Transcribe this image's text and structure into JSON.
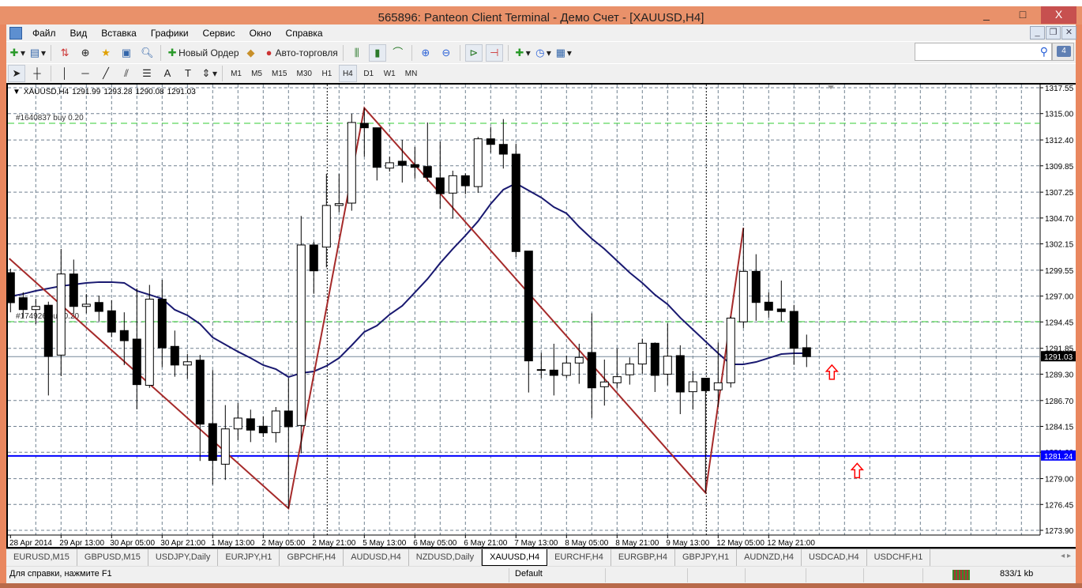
{
  "window": {
    "title": "565896: Panteon Client Terminal - Демо Счет - [XAUUSD,H4]",
    "minimize": "_",
    "maximize": "□",
    "close": "X"
  },
  "menu": [
    "Файл",
    "Вид",
    "Вставка",
    "Графики",
    "Сервис",
    "Окно",
    "Справка"
  ],
  "mdi": {
    "minimize": "_",
    "restore": "❐",
    "close": "✕"
  },
  "toolbar": {
    "new_order": "Новый Ордер",
    "auto_trading": "Авто-торговля",
    "messages_count": "4",
    "search_placeholder": ""
  },
  "timeframes": [
    "M1",
    "M5",
    "M15",
    "M30",
    "H1",
    "H4",
    "D1",
    "W1",
    "MN"
  ],
  "active_timeframe": "H4",
  "chart": {
    "symbol": "XAUUSD,H4",
    "open": "1291.99",
    "high": "1293.28",
    "low": "1290.08",
    "close": "1291.03"
  },
  "chart_data": {
    "type": "candlestick",
    "symbol": "XAUUSD",
    "timeframe": "H4",
    "ylim": [
      1273.9,
      1317.55
    ],
    "price_ticks": [
      "1317.55",
      "1315.00",
      "1312.40",
      "1309.85",
      "1307.25",
      "1304.70",
      "1302.15",
      "1299.55",
      "1297.00",
      "1294.45",
      "1291.85",
      "1289.30",
      "1286.70",
      "1284.15",
      "1281.60",
      "1279.00",
      "1276.45",
      "1273.90"
    ],
    "time_labels": [
      {
        "index": 0,
        "label": "28 Apr 2014"
      },
      {
        "index": 4,
        "label": "29 Apr 13:00"
      },
      {
        "index": 8,
        "label": "30 Apr 05:00"
      },
      {
        "index": 12,
        "label": "30 Apr 21:00"
      },
      {
        "index": 16,
        "label": "1 May 13:00"
      },
      {
        "index": 20,
        "label": "2 May 05:00"
      },
      {
        "index": 24,
        "label": "2 May 21:00"
      },
      {
        "index": 28,
        "label": "5 May 13:00"
      },
      {
        "index": 32,
        "label": "6 May 05:00"
      },
      {
        "index": 36,
        "label": "6 May 21:00"
      },
      {
        "index": 40,
        "label": "7 May 13:00"
      },
      {
        "index": 44,
        "label": "8 May 05:00"
      },
      {
        "index": 48,
        "label": "8 May 21:00"
      },
      {
        "index": 52,
        "label": "9 May 13:00"
      },
      {
        "index": 56,
        "label": "12 May 05:00"
      },
      {
        "index": 60,
        "label": "12 May 21:00"
      }
    ],
    "ohlc": [
      [
        1299.31,
        1299.7,
        1295.4,
        1296.35
      ],
      [
        1296.84,
        1297.37,
        1294.89,
        1295.67
      ],
      [
        1295.67,
        1296.74,
        1294.24,
        1295.98
      ],
      [
        1296.1,
        1296.45,
        1287.2,
        1291.05
      ],
      [
        1291.18,
        1301.65,
        1289.1,
        1299.18
      ],
      [
        1299.18,
        1300.6,
        1295.3,
        1295.98
      ],
      [
        1295.98,
        1297.2,
        1295.3,
        1296.2
      ],
      [
        1296.37,
        1297.05,
        1294.5,
        1295.49
      ],
      [
        1295.55,
        1296.6,
        1292.95,
        1293.45
      ],
      [
        1293.6,
        1295.4,
        1290.2,
        1292.6
      ],
      [
        1292.76,
        1297.75,
        1285.83,
        1288.27
      ],
      [
        1288.2,
        1298.1,
        1287.95,
        1296.7
      ],
      [
        1296.7,
        1298.6,
        1290.0,
        1291.9
      ],
      [
        1292.04,
        1293.6,
        1289.05,
        1290.2
      ],
      [
        1290.2,
        1291.3,
        1288.85,
        1290.52
      ],
      [
        1290.68,
        1291.2,
        1280.74,
        1284.37
      ],
      [
        1284.42,
        1289.7,
        1278.4,
        1280.79
      ],
      [
        1280.42,
        1286.25,
        1278.87,
        1283.9
      ],
      [
        1283.9,
        1286.45,
        1282.8,
        1284.97
      ],
      [
        1284.9,
        1285.8,
        1282.6,
        1283.78
      ],
      [
        1284.17,
        1285.15,
        1283.1,
        1283.51
      ],
      [
        1283.54,
        1286.06,
        1282.56,
        1285.67
      ],
      [
        1285.67,
        1288.92,
        1276.06,
        1284.11
      ],
      [
        1284.24,
        1304.9,
        1281.5,
        1302.04
      ],
      [
        1302.04,
        1302.35,
        1297.23,
        1299.49
      ],
      [
        1301.83,
        1309.05,
        1299.83,
        1305.94
      ],
      [
        1305.94,
        1309.05,
        1305.29,
        1306.12
      ],
      [
        1306.17,
        1314.98,
        1305.42,
        1314.12
      ],
      [
        1314.04,
        1315.55,
        1310.75,
        1313.6
      ],
      [
        1313.6,
        1313.6,
        1308.4,
        1309.7
      ],
      [
        1309.62,
        1310.75,
        1309.27,
        1310.15
      ],
      [
        1310.3,
        1312.4,
        1308.2,
        1309.9
      ],
      [
        1309.97,
        1311.7,
        1308.6,
        1309.7
      ],
      [
        1309.78,
        1314.12,
        1308.27,
        1308.72
      ],
      [
        1308.66,
        1312.23,
        1305.63,
        1307.1
      ],
      [
        1307.16,
        1309.37,
        1304.64,
        1308.87
      ],
      [
        1308.87,
        1309.1,
        1307.05,
        1307.88
      ],
      [
        1307.8,
        1312.7,
        1307.18,
        1312.51
      ],
      [
        1312.51,
        1313.68,
        1311.13,
        1311.96
      ],
      [
        1311.96,
        1314.46,
        1309.58,
        1311.0
      ],
      [
        1311.0,
        1312.04,
        1300.87,
        1301.39
      ],
      [
        1301.44,
        1301.44,
        1287.49,
        1290.61
      ],
      [
        1289.75,
        1291.4,
        1288.9,
        1289.75
      ],
      [
        1289.7,
        1292.3,
        1287.2,
        1289.18
      ],
      [
        1289.18,
        1291.13,
        1288.92,
        1290.4
      ],
      [
        1290.4,
        1292.3,
        1288.35,
        1290.95
      ],
      [
        1291.44,
        1295.3,
        1285.0,
        1287.95
      ],
      [
        1288.06,
        1290.74,
        1286.2,
        1288.53
      ],
      [
        1288.45,
        1291.85,
        1287.88,
        1289.05
      ],
      [
        1289.24,
        1290.95,
        1288.27,
        1290.3
      ],
      [
        1290.3,
        1292.8,
        1289.35,
        1292.35
      ],
      [
        1292.35,
        1292.43,
        1287.54,
        1289.18
      ],
      [
        1289.3,
        1294.3,
        1288.2,
        1291.07
      ],
      [
        1291.13,
        1292.15,
        1285.36,
        1287.54
      ],
      [
        1287.57,
        1289.63,
        1285.8,
        1288.55
      ],
      [
        1288.9,
        1288.9,
        1277.6,
        1287.67
      ],
      [
        1287.75,
        1292.43,
        1286.06,
        1288.45
      ],
      [
        1288.45,
        1295.0,
        1287.98,
        1294.83
      ],
      [
        1294.46,
        1303.73,
        1293.85,
        1299.44
      ],
      [
        1299.44,
        1301.13,
        1294.56,
        1296.37
      ],
      [
        1296.4,
        1297.36,
        1294.89,
        1295.6
      ],
      [
        1295.73,
        1298.53,
        1294.5,
        1295.47
      ],
      [
        1295.49,
        1296.14,
        1290.22,
        1291.85
      ],
      [
        1291.91,
        1293.2,
        1290.0,
        1291.03
      ]
    ],
    "moving_average": [
      1296.97,
      1297.21,
      1297.52,
      1297.75,
      1297.99,
      1298.14,
      1298.3,
      1298.38,
      1298.38,
      1298.3,
      1297.52,
      1297.13,
      1296.74,
      1295.65,
      1295.1,
      1294.25,
      1292.92,
      1292.22,
      1291.52,
      1290.89,
      1290.19,
      1289.8,
      1289.02,
      1289.41,
      1289.57,
      1290.11,
      1290.89,
      1292.14,
      1293.47,
      1294.09,
      1295.18,
      1296.04,
      1297.36,
      1298.69,
      1300.25,
      1301.65,
      1302.97,
      1304.38,
      1306.09,
      1307.5,
      1308.12,
      1307.42,
      1306.72,
      1305.78,
      1305.16,
      1303.83,
      1302.66,
      1301.65,
      1300.48,
      1299.31,
      1298.3,
      1297.13,
      1296.19,
      1294.87,
      1293.7,
      1292.53,
      1291.36,
      1290.27,
      1290.27,
      1290.5,
      1290.89,
      1291.28,
      1291.36,
      1291.36
    ],
    "zigzag": [
      [
        -0.1,
        1300.7
      ],
      [
        22,
        1276.06
      ],
      [
        28,
        1315.55
      ],
      [
        55,
        1277.6
      ],
      [
        58,
        1303.73
      ]
    ],
    "vertical_lines": [
      25,
      55
    ],
    "orders": [
      {
        "label": "#1640837 buy 0.20",
        "price": 1314.04
      },
      {
        "label": "#174926 buy 0.20",
        "price": 1294.48
      }
    ],
    "hlines": [
      {
        "price": 1281.24,
        "label": "1281.24",
        "color": "#0000ff"
      }
    ],
    "bid": {
      "price": 1291.03,
      "label": "1291.03"
    },
    "arrows": [
      {
        "index": 65,
        "price": 1290.2,
        "direction": "up"
      },
      {
        "index": 67,
        "price": 1280.5,
        "direction": "up"
      }
    ],
    "colors": {
      "zigzag": "#a52a2a",
      "ma": "#191970",
      "order": "#33cc33",
      "grid": "#708090"
    }
  },
  "tabs": [
    {
      "label": "EURUSD,M15"
    },
    {
      "label": "GBPUSD,M15"
    },
    {
      "label": "USDJPY,Daily"
    },
    {
      "label": "EURJPY,H1"
    },
    {
      "label": "GBPCHF,H4"
    },
    {
      "label": "AUDUSD,H4"
    },
    {
      "label": "NZDUSD,Daily"
    },
    {
      "label": "XAUUSD,H4",
      "active": true
    },
    {
      "label": "EURCHF,H4"
    },
    {
      "label": "EURGBP,H4"
    },
    {
      "label": "GBPJPY,H1"
    },
    {
      "label": "AUDNZD,H4"
    },
    {
      "label": "USDCAD,H4"
    },
    {
      "label": "USDCHF,H1"
    }
  ],
  "status": {
    "help": "Для справки, нажмите F1",
    "profile": "Default",
    "traffic": "833/1 kb"
  }
}
